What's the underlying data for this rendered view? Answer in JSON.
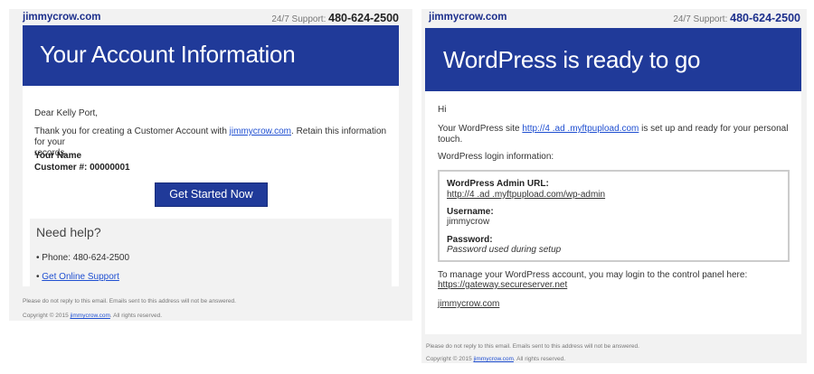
{
  "left_email": {
    "brand": "jimmycrow.com",
    "support_label": "24/7 Support:",
    "support_phone": "480-624-2500",
    "hero_title": "Your Account Information",
    "greeting": "Dear Kelly Port,",
    "intro_before": "Thank you for creating a Customer Account with ",
    "intro_link": "jimmycrow.com",
    "intro_after": ". Retain this information for your",
    "intro_line2": "records.",
    "name_label": "Your Name",
    "customer_label": "Customer #: 00000001",
    "cta_label": "Get Started Now",
    "help_title": "Need help?",
    "help_phone": "• Phone: 480-624-2500",
    "help_bullet": "• ",
    "help_link": "Get Online Support",
    "footer_note": "Please do not reply to this email. Emails sent to this address will not be answered.",
    "copyright_prefix": "Copyright © 2015 ",
    "copyright_link": "jimmycrow.com",
    "copyright_suffix": ". All rights reserved."
  },
  "right_email": {
    "brand": "jimmycrow.com",
    "support_label": "24/7 Support:",
    "support_phone": "480-624-2500",
    "hero_title": "WordPress is ready to go",
    "greeting": "Hi",
    "site_before": "Your WordPress site ",
    "site_link": "http://4 .ad .myftpupload.com",
    "site_after": " is set up and ready for your personal",
    "site_line2": "touch.",
    "login_info": "WordPress login information:",
    "admin_url_label": "WordPress Admin URL:",
    "admin_url": "http://4 .ad .myftpupload.com/wp-admin",
    "username_label": "Username:",
    "username": "jimmycrow",
    "password_label": "Password:",
    "password": "Password used during setup",
    "manage_text": "To manage your WordPress account, you may login to the control panel here:",
    "gateway_link": "https://gateway.secureserver.net",
    "signature_link": "jimmycrow.com",
    "footer_note": "Please do not reply to this email. Emails sent to this address will not be answered.",
    "copyright_prefix": "Copyright © 2015 ",
    "copyright_link": "jimmycrow.com",
    "copyright_suffix": ". All rights reserved."
  },
  "colors": {
    "brand_blue": "#203a99",
    "link_blue": "#1f4fd1",
    "panel_gray": "#f2f2f2"
  }
}
